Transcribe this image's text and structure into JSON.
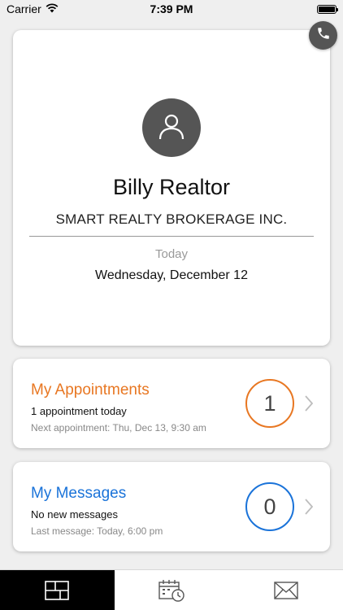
{
  "status_bar": {
    "carrier": "Carrier",
    "time": "7:39 PM"
  },
  "profile": {
    "name": "Billy Realtor",
    "company": "SMART REALTY BROKERAGE INC.",
    "today_label": "Today",
    "today_date": "Wednesday, December 12"
  },
  "appointments": {
    "title": "My Appointments",
    "summary": "1 appointment today",
    "detail": "Next appointment: Thu, Dec 13, 9:30 am",
    "count": "1",
    "accent": "#e87722"
  },
  "messages": {
    "title": "My Messages",
    "summary": "No new messages",
    "detail": "Last message: Today, 6:00 pm",
    "count": "0",
    "accent": "#1a73d9"
  },
  "tab_bar": {
    "tabs": [
      {
        "icon": "dashboard-icon",
        "active": true
      },
      {
        "icon": "calendar-clock-icon",
        "active": false
      },
      {
        "icon": "mail-icon",
        "active": false
      }
    ]
  }
}
